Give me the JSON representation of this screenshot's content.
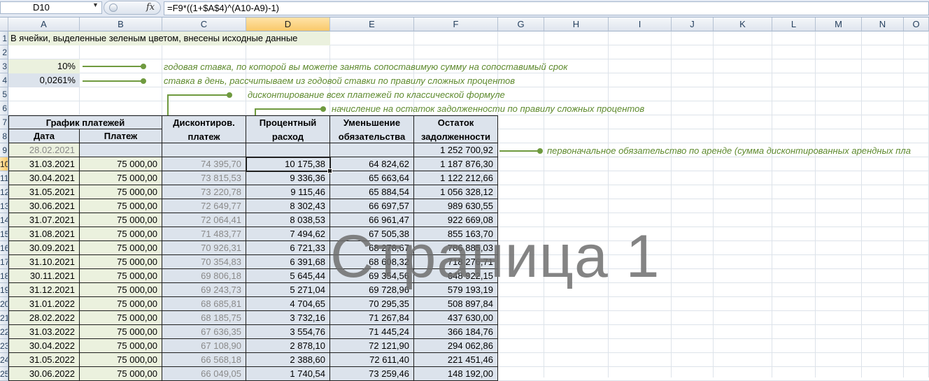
{
  "formula_bar": {
    "name_box": "D10",
    "fx_label": "fx",
    "formula": "=F9*((1+$A$4)^(A10-A9)-1)"
  },
  "columns": [
    "A",
    "B",
    "C",
    "D",
    "E",
    "F",
    "G",
    "H",
    "I",
    "J",
    "K",
    "L",
    "M",
    "N",
    "O"
  ],
  "row_numbers": [
    "1",
    "2",
    "3",
    "4",
    "5",
    "6",
    "7",
    "8",
    "9",
    "10",
    "11",
    "12",
    "13",
    "14",
    "15",
    "16",
    "17",
    "18",
    "19",
    "20",
    "21",
    "22",
    "23",
    "24",
    "25"
  ],
  "intro_text": "В ячейки, выделенные зеленым цветом, внесены исходные данные",
  "inputs": {
    "annual_rate": "10%",
    "daily_rate": "0,0261%"
  },
  "notes": {
    "annual": "годовая ставка, по которой вы можете занять сопоставимую сумму на сопоставимый срок",
    "daily": "ставка в день, рассчитываем из годовой ставки по правилу сложных процентов",
    "discount": "дисконтирование всех платежей по классической формуле",
    "interest": "начисление на остаток задолженности по правилу сложных процентов",
    "initial": "первоначальное обязательство по аренде (сумма дисконтированных арендных пла"
  },
  "table": {
    "group_header": "График платежей",
    "headers": {
      "date": "Дата",
      "payment": "Платеж",
      "discounted_1": "Дисконтиров.",
      "discounted_2": "платеж",
      "interest_1": "Процентный",
      "interest_2": "расход",
      "reduction_1": "Уменьшение",
      "reduction_2": "обязательства",
      "balance_1": "Остаток",
      "balance_2": "задолженности"
    },
    "initial_row": {
      "date": "28.02.2021",
      "balance": "1 252 700,92"
    },
    "rows": [
      {
        "date": "31.03.2021",
        "payment": "75 000,00",
        "discounted": "74 395,70",
        "interest": "10 175,38",
        "reduction": "64 824,62",
        "balance": "1 187 876,30"
      },
      {
        "date": "30.04.2021",
        "payment": "75 000,00",
        "discounted": "73 815,53",
        "interest": "9 336,36",
        "reduction": "65 663,64",
        "balance": "1 122 212,66"
      },
      {
        "date": "31.05.2021",
        "payment": "75 000,00",
        "discounted": "73 220,78",
        "interest": "9 115,46",
        "reduction": "65 884,54",
        "balance": "1 056 328,12"
      },
      {
        "date": "30.06.2021",
        "payment": "75 000,00",
        "discounted": "72 649,77",
        "interest": "8 302,43",
        "reduction": "66 697,57",
        "balance": "989 630,55"
      },
      {
        "date": "31.07.2021",
        "payment": "75 000,00",
        "discounted": "72 064,41",
        "interest": "8 038,53",
        "reduction": "66 961,47",
        "balance": "922 669,08"
      },
      {
        "date": "31.08.2021",
        "payment": "75 000,00",
        "discounted": "71 483,77",
        "interest": "7 494,62",
        "reduction": "67 505,38",
        "balance": "855 163,70"
      },
      {
        "date": "30.09.2021",
        "payment": "75 000,00",
        "discounted": "70 926,31",
        "interest": "6 721,33",
        "reduction": "68 278,67",
        "balance": "786 885,03"
      },
      {
        "date": "31.10.2021",
        "payment": "75 000,00",
        "discounted": "70 354,83",
        "interest": "6 391,68",
        "reduction": "68 608,32",
        "balance": "718 276,71"
      },
      {
        "date": "30.11.2021",
        "payment": "75 000,00",
        "discounted": "69 806,18",
        "interest": "5 645,44",
        "reduction": "69 354,56",
        "balance": "648 922,15"
      },
      {
        "date": "31.12.2021",
        "payment": "75 000,00",
        "discounted": "69 243,73",
        "interest": "5 271,04",
        "reduction": "69 728,96",
        "balance": "579 193,19"
      },
      {
        "date": "31.01.2022",
        "payment": "75 000,00",
        "discounted": "68 685,81",
        "interest": "4 704,65",
        "reduction": "70 295,35",
        "balance": "508 897,84"
      },
      {
        "date": "28.02.2022",
        "payment": "75 000,00",
        "discounted": "68 185,75",
        "interest": "3 732,16",
        "reduction": "71 267,84",
        "balance": "437 630,00"
      },
      {
        "date": "31.03.2022",
        "payment": "75 000,00",
        "discounted": "67 636,35",
        "interest": "3 554,76",
        "reduction": "71 445,24",
        "balance": "366 184,76"
      },
      {
        "date": "30.04.2022",
        "payment": "75 000,00",
        "discounted": "67 108,90",
        "interest": "2 878,10",
        "reduction": "72 121,90",
        "balance": "294 062,86"
      },
      {
        "date": "31.05.2022",
        "payment": "75 000,00",
        "discounted": "66 568,18",
        "interest": "2 388,60",
        "reduction": "72 611,40",
        "balance": "221 451,46"
      },
      {
        "date": "30.06.2022",
        "payment": "75 000,00",
        "discounted": "66 049,05",
        "interest": "1 740,54",
        "reduction": "73 259,46",
        "balance": "148 192,00"
      }
    ]
  },
  "watermark": "Страница 1",
  "colors": {
    "input_green": "#ebf1de",
    "table_blue": "#dce3ec",
    "annotation_green": "#6f9a3f",
    "selected_header": "#f9c96a"
  }
}
